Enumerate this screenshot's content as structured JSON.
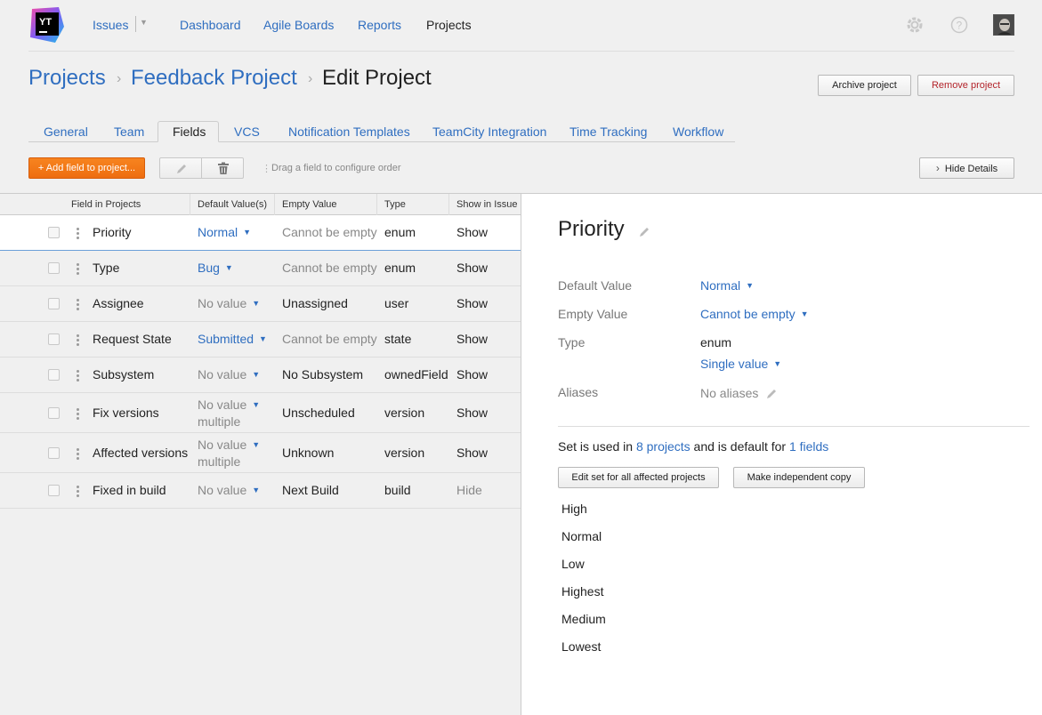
{
  "logo_text": "YT",
  "nav": {
    "issues": "Issues",
    "dashboard": "Dashboard",
    "agile_boards": "Agile Boards",
    "reports": "Reports",
    "projects": "Projects"
  },
  "breadcrumb": {
    "root": "Projects",
    "project": "Feedback Project",
    "current": "Edit Project"
  },
  "header_buttons": {
    "archive": "Archive project",
    "remove": "Remove project"
  },
  "tabs": [
    "General",
    "Team",
    "Fields",
    "VCS",
    "Notification Templates",
    "TeamCity Integration",
    "Time Tracking",
    "Workflow"
  ],
  "active_tab": "Fields",
  "toolbar": {
    "add_field": "+ Add field to project...",
    "drag_hint": "Drag a field to configure order",
    "hide_details": "Hide Details"
  },
  "table": {
    "headers": [
      "Field in Projects",
      "Default Value(s)",
      "Empty Value",
      "Type",
      "Show in Issue"
    ],
    "rows": [
      {
        "name": "Priority",
        "default": "Normal",
        "default_sub": "",
        "empty": "Cannot be empty",
        "type": "enum",
        "show": "Show"
      },
      {
        "name": "Type",
        "default": "Bug",
        "default_sub": "",
        "empty": "Cannot be empty",
        "type": "enum",
        "show": "Show"
      },
      {
        "name": "Assignee",
        "default": "No value",
        "default_sub": "",
        "empty": "Unassigned",
        "type": "user",
        "show": "Show"
      },
      {
        "name": "Request State",
        "default": "Submitted",
        "default_sub": "",
        "empty": "Cannot be empty",
        "type": "state",
        "show": "Show"
      },
      {
        "name": "Subsystem",
        "default": "No value",
        "default_sub": "",
        "empty": "No Subsystem",
        "type": "ownedField",
        "show": "Show"
      },
      {
        "name": "Fix versions",
        "default": "No value",
        "default_sub": "multiple",
        "empty": "Unscheduled",
        "type": "version",
        "show": "Show"
      },
      {
        "name": "Affected versions",
        "default": "No value",
        "default_sub": "multiple",
        "empty": "Unknown",
        "type": "version",
        "show": "Show"
      },
      {
        "name": "Fixed in build",
        "default": "No value",
        "default_sub": "",
        "empty": "Next Build",
        "type": "build",
        "show": "Hide"
      }
    ]
  },
  "details": {
    "title": "Priority",
    "default_value_label": "Default Value",
    "default_value": "Normal",
    "empty_value_label": "Empty Value",
    "empty_value": "Cannot be empty",
    "type_label": "Type",
    "type": "enum",
    "cardinality": "Single value",
    "aliases_label": "Aliases",
    "aliases": "No aliases",
    "usage_prefix": "Set is used in",
    "usage_projects": "8 projects",
    "usage_middle": "and is default for",
    "usage_fields": "1 fields",
    "edit_set_button": "Edit set for all affected projects",
    "copy_button": "Make independent copy",
    "values": [
      "High",
      "Normal",
      "Low",
      "Highest",
      "Medium",
      "Lowest"
    ]
  },
  "colors": {
    "link": "#2f6ec0",
    "add_button": "#f47a1a",
    "remove_text": "#b3242b",
    "background": "#f0f0f0"
  }
}
